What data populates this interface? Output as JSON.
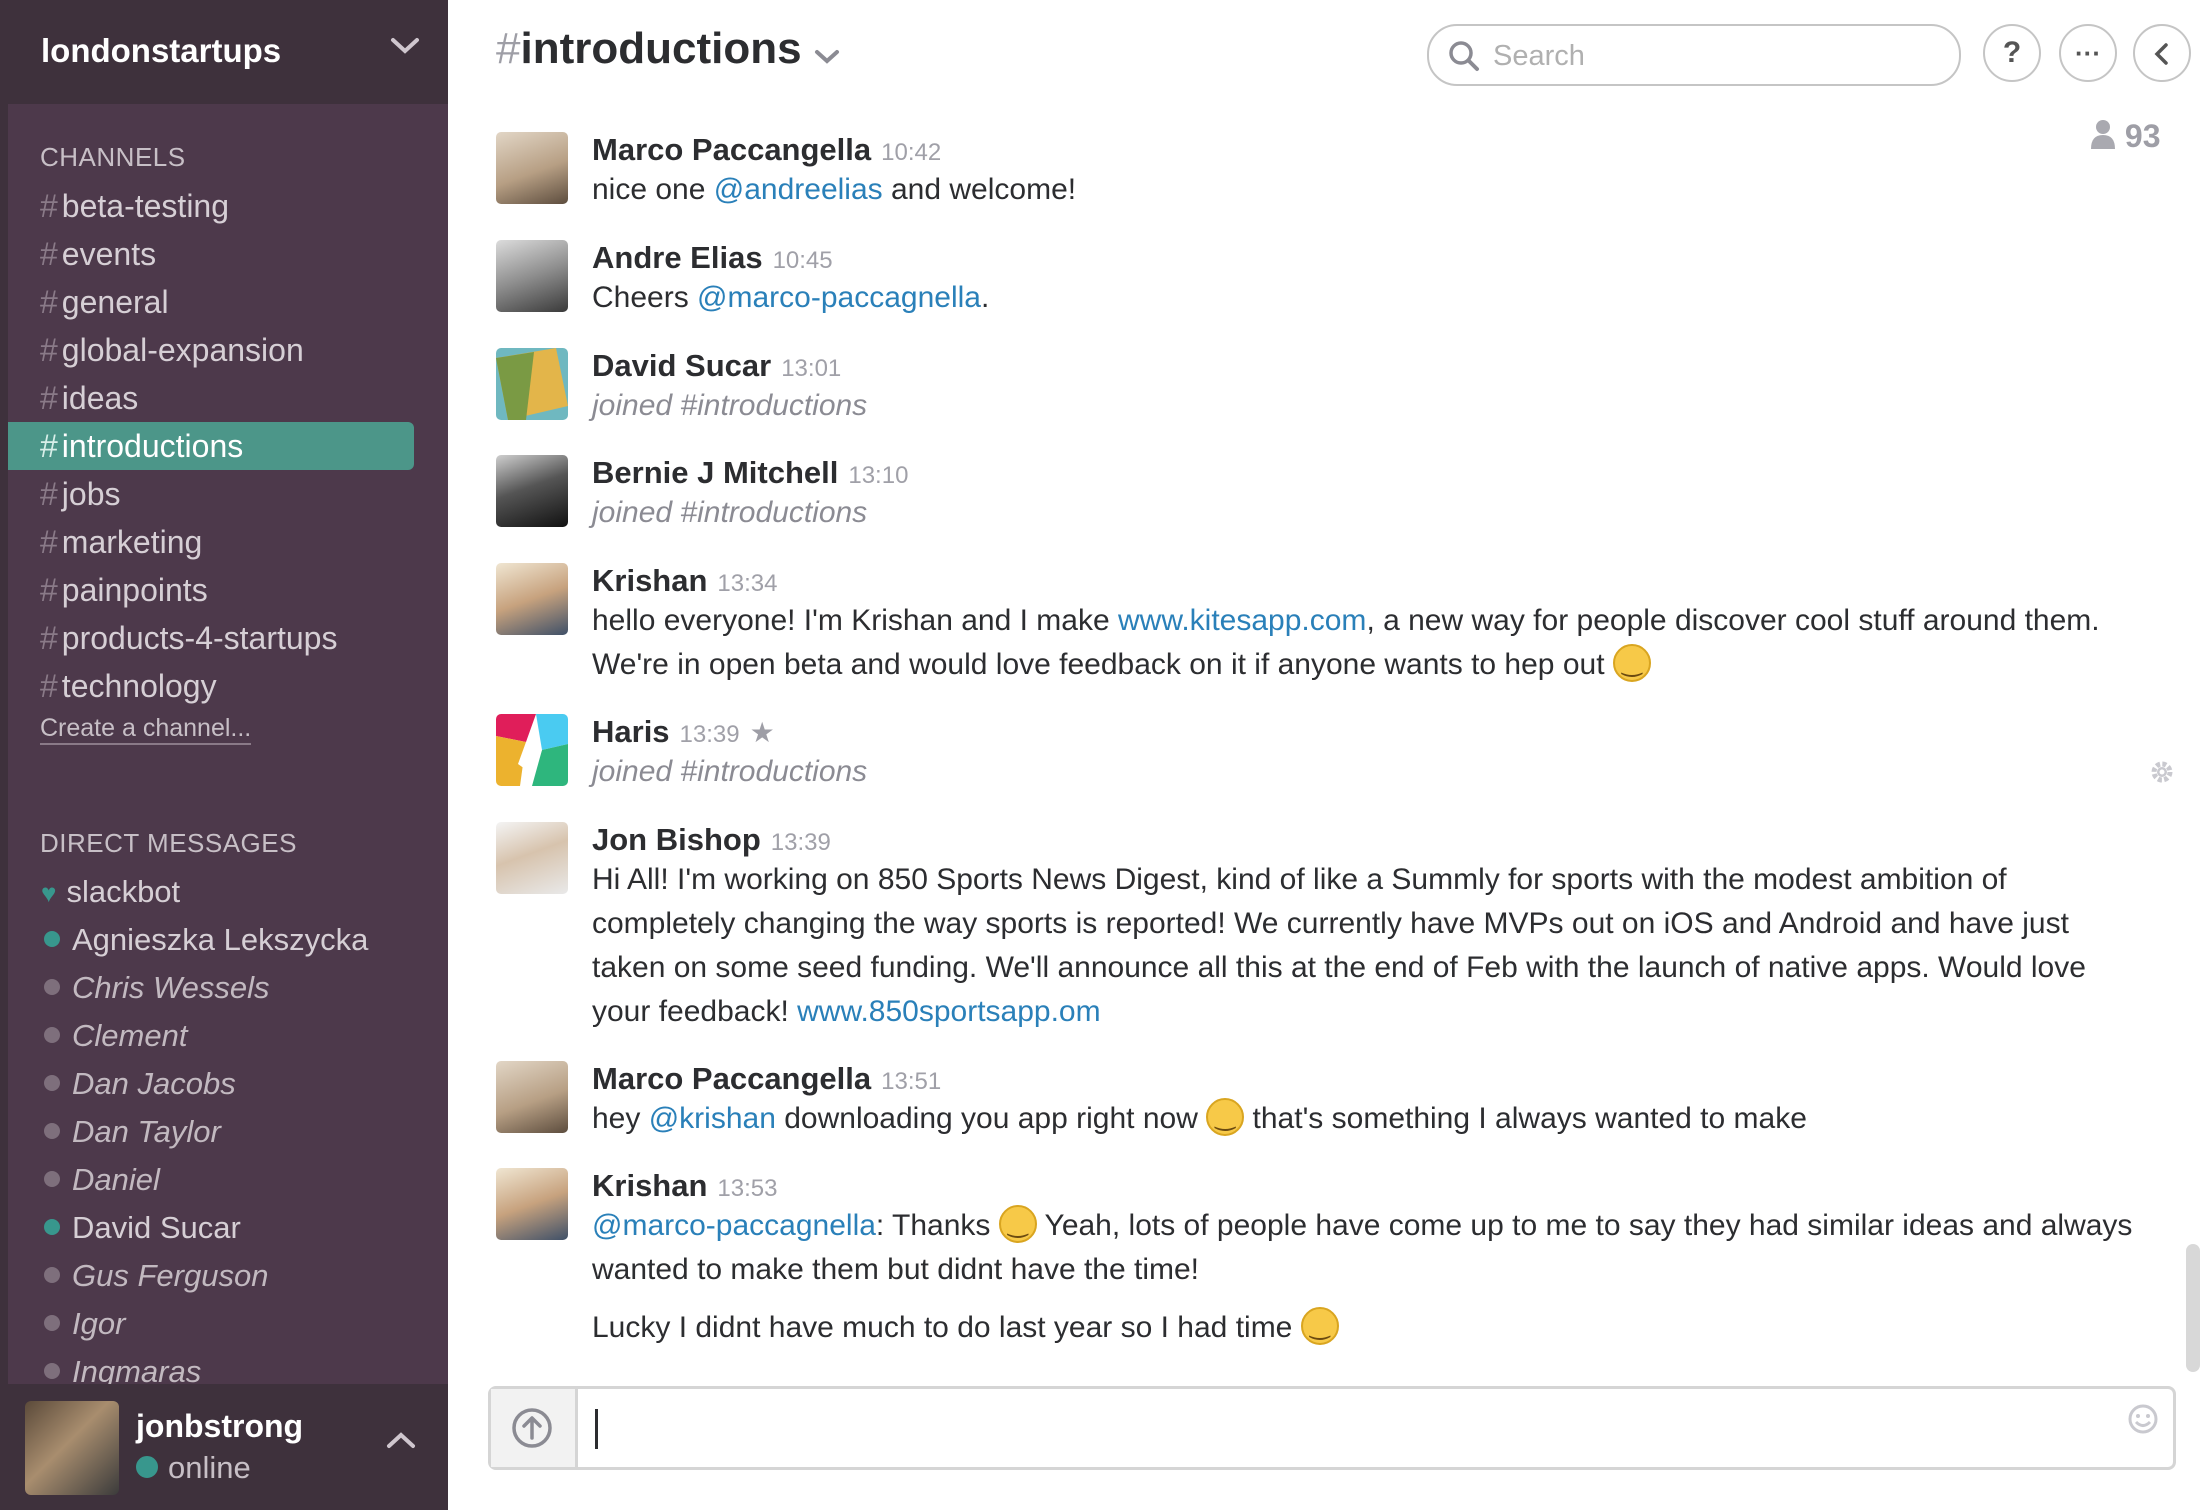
{
  "team": {
    "name": "londonstartups"
  },
  "sidebar": {
    "channels_title": "CHANNELS",
    "channels": [
      {
        "label": "beta-testing"
      },
      {
        "label": "events"
      },
      {
        "label": "general"
      },
      {
        "label": "global-expansion"
      },
      {
        "label": "ideas"
      },
      {
        "label": "introductions",
        "active": true
      },
      {
        "label": "jobs"
      },
      {
        "label": "marketing"
      },
      {
        "label": "painpoints"
      },
      {
        "label": "products-4-startups"
      },
      {
        "label": "technology"
      }
    ],
    "create_channel": "Create a channel...",
    "dm_title": "DIRECT MESSAGES",
    "dms": [
      {
        "name": "slackbot",
        "status": "bot"
      },
      {
        "name": "Agnieszka Lekszycka",
        "status": "online"
      },
      {
        "name": "Chris Wessels",
        "status": "away"
      },
      {
        "name": "Clement",
        "status": "away"
      },
      {
        "name": "Dan Jacobs",
        "status": "away"
      },
      {
        "name": "Dan Taylor",
        "status": "away"
      },
      {
        "name": "Daniel",
        "status": "away"
      },
      {
        "name": "David Sucar",
        "status": "online"
      },
      {
        "name": "Gus Ferguson",
        "status": "away"
      },
      {
        "name": "Igor",
        "status": "away"
      },
      {
        "name": "Ingmaras",
        "status": "away"
      }
    ]
  },
  "user": {
    "name": "jonbstrong",
    "status": "online"
  },
  "header": {
    "hash": "#",
    "channel": "introductions",
    "search_placeholder": "Search",
    "help_label": "?",
    "more_label": "···",
    "member_count": "93"
  },
  "messages": [
    {
      "sender": "Marco Paccangella",
      "time": "10:42",
      "avatar_color": "#c9b8a0",
      "parts": {
        "a": "nice one ",
        "mention": "@andreelias",
        "b": " and welcome!"
      }
    },
    {
      "sender": "Andre Elias",
      "time": "10:45",
      "avatar_color": "#8a8a8a",
      "parts": {
        "a": "Cheers ",
        "mention": "@marco-paccagnella",
        "b": "."
      }
    },
    {
      "sender": "David Sucar",
      "time": "13:01",
      "joined": "joined #introductions"
    },
    {
      "sender": "Bernie J Mitchell",
      "time": "13:10",
      "joined": "joined #introductions"
    },
    {
      "sender": "Krishan",
      "time": "13:34",
      "parts": {
        "a": "hello everyone!  I'm Krishan and I make ",
        "link": "www.kitesapp.com",
        "b": ", a new way for people discover cool stuff around them. We're in open beta and would love feedback on it if anyone wants to hep out "
      }
    },
    {
      "sender": "Haris",
      "time": "13:39",
      "joined": "joined #introductions"
    },
    {
      "sender": "Jon Bishop",
      "time": "13:39",
      "parts": {
        "a": "Hi All! I'm working on 850 Sports News Digest, kind of like a Summly for sports with the modest ambition of completely changing the way sports is reported! We currently have MVPs out on iOS and Android and have just taken on some seed funding. We'll announce all this at the end of Feb with the launch of native apps. Would love your feedback! ",
        "link": "www.850sportsapp.om"
      }
    },
    {
      "sender": "Marco Paccangella",
      "time": "13:51",
      "parts": {
        "a": "hey ",
        "mention": "@krishan",
        "b": " downloading you app right now ",
        "c": " that's something I always wanted to make"
      }
    },
    {
      "sender": "Krishan",
      "time": "13:53",
      "parts": {
        "mention": "@marco-paccagnella",
        "a": ": Thanks ",
        "b": " Yeah, lots of people have come up to me to say they had similar ideas and always wanted to make them but didnt have the time!",
        "c": "Lucky I didnt have much to do last year so I had time "
      }
    }
  ]
}
